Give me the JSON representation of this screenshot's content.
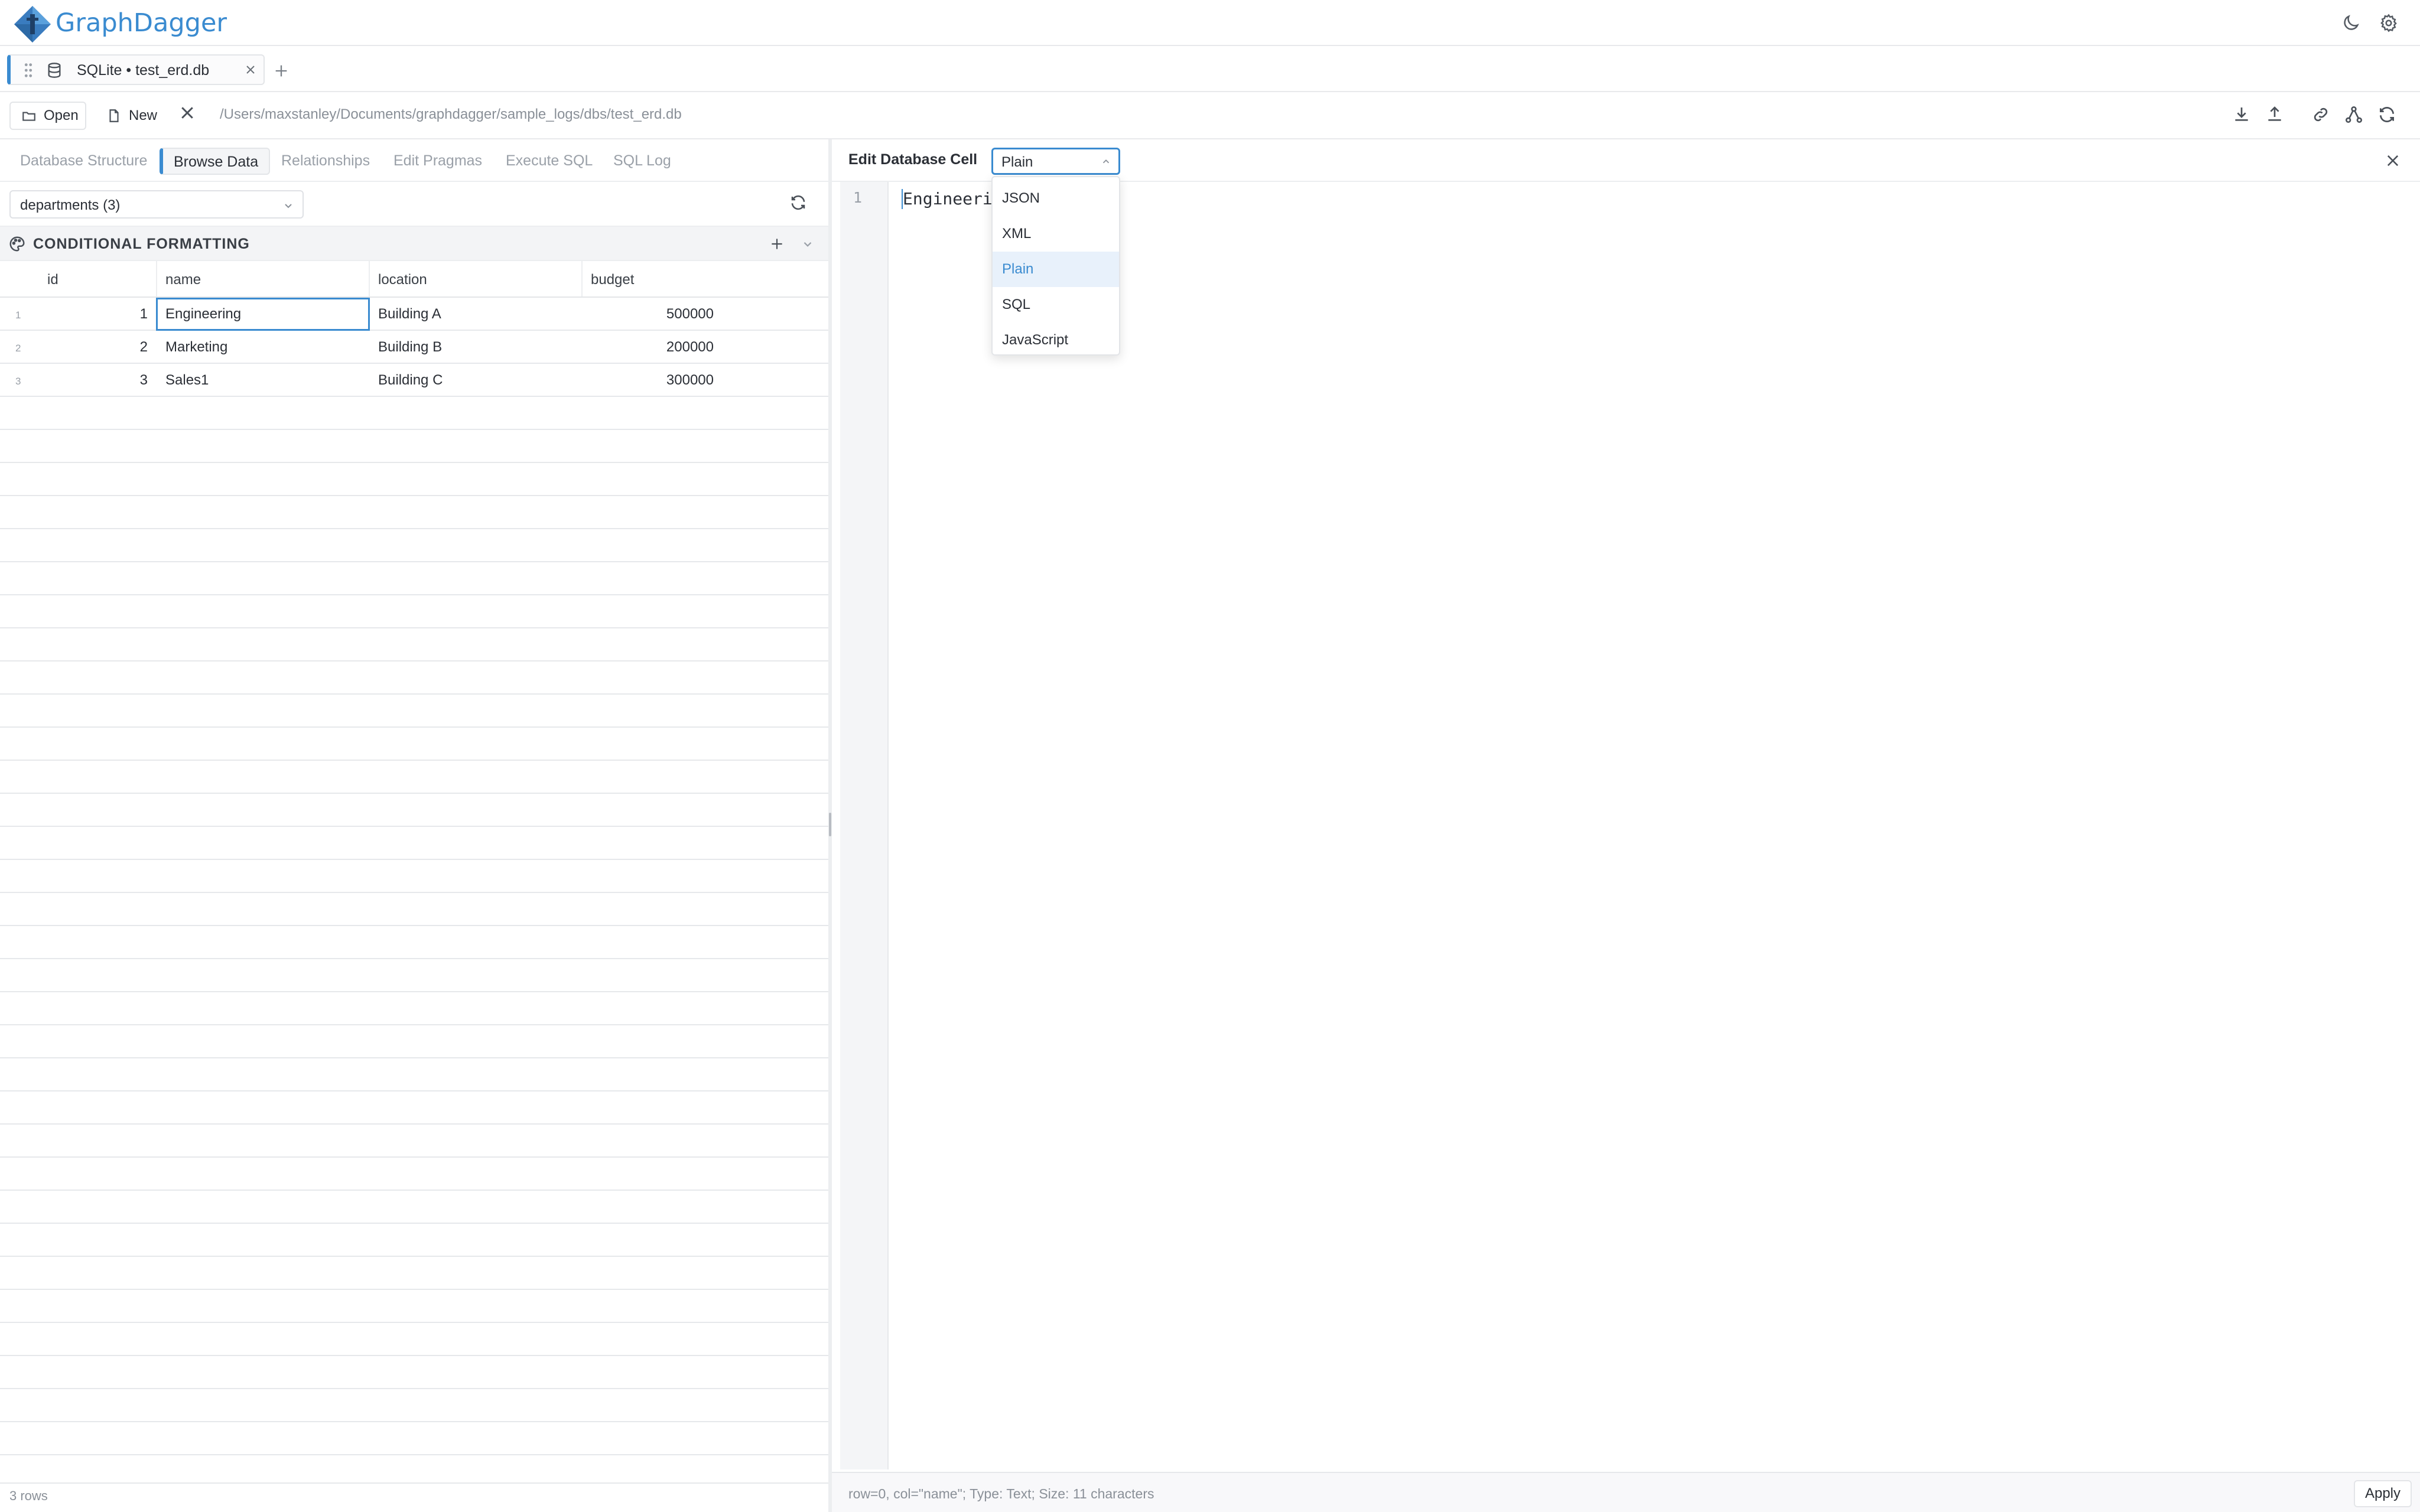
{
  "app": {
    "brand": "GraphDagger"
  },
  "tabs": [
    {
      "label": "SQLite • test_erd.db"
    }
  ],
  "toolbar": {
    "open_label": "Open",
    "new_label": "New",
    "path": "/Users/maxstanley/Documents/graphdagger/sample_logs/dbs/test_erd.db"
  },
  "left": {
    "subtabs": [
      "Database Structure",
      "Browse Data",
      "Relationships",
      "Edit Pragmas",
      "Execute SQL",
      "SQL Log"
    ],
    "active_subtab": "Browse Data",
    "table_select": "departments (3)",
    "cf_title": "CONDITIONAL FORMATTING",
    "columns": [
      "id",
      "name",
      "location",
      "budget"
    ],
    "rows": [
      {
        "rownum": "1",
        "id": "1",
        "name": "Engineering",
        "location": "Building A",
        "budget": "500000"
      },
      {
        "rownum": "2",
        "id": "2",
        "name": "Marketing",
        "location": "Building B",
        "budget": "200000"
      },
      {
        "rownum": "3",
        "id": "3",
        "name": "Sales1",
        "location": "Building C",
        "budget": "300000"
      }
    ],
    "footer": "3 rows"
  },
  "right": {
    "title": "Edit Database Cell",
    "mode": "Plain",
    "mode_options": [
      "JSON",
      "XML",
      "Plain",
      "SQL",
      "JavaScript"
    ],
    "line_number": "1",
    "code": "Engineerin",
    "status": "row=0, col=\"name\"; Type: Text; Size: 11 characters",
    "apply_label": "Apply"
  },
  "colors": {
    "accent": "#3a8bd0",
    "selected_option_bg": "#e8f1fb"
  },
  "icons": [
    "graphdagger-logo-icon",
    "moon-icon",
    "gear-icon",
    "drag-grip-icon",
    "database-icon",
    "close-icon",
    "plus-icon",
    "folder-open-icon",
    "file-icon",
    "download-icon",
    "upload-icon",
    "link-icon",
    "graph-icon",
    "refresh-icon",
    "palette-icon",
    "chevron-down-icon",
    "chevron-up-icon"
  ]
}
